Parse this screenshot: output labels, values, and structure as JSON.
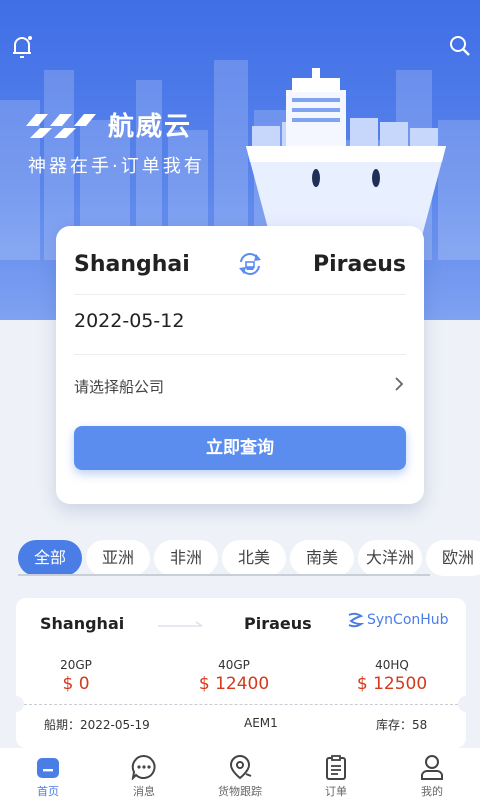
{
  "header": {
    "brand_name": "航威云",
    "slogan": "神器在手·订单我有",
    "bell_icon": "bell-icon",
    "search_icon": "search-icon"
  },
  "search_card": {
    "origin": "Shanghai",
    "destination": "Piraeus",
    "date": "2022-05-12",
    "carrier_placeholder": "请选择船公司",
    "query_button": "立即查询"
  },
  "region_tabs": {
    "items": [
      "全部",
      "亚洲",
      "非洲",
      "北美",
      "南美",
      "大洋洲",
      "欧洲"
    ],
    "active_index": 0
  },
  "result": {
    "origin": "Shanghai",
    "destination": "Piraeus",
    "carrier": "SynConHub",
    "prices": [
      {
        "type": "20GP",
        "price": "$ 0"
      },
      {
        "type": "40GP",
        "price": "$ 12400"
      },
      {
        "type": "40HQ",
        "price": "$ 12500"
      }
    ],
    "sailing_date": "船期：2022-05-19",
    "route_code": "AEM1",
    "stock": "库存：58"
  },
  "nav": {
    "items": [
      {
        "label": "首页",
        "icon": "home-icon"
      },
      {
        "label": "消息",
        "icon": "message-icon"
      },
      {
        "label": "货物跟踪",
        "icon": "location-pin-icon"
      },
      {
        "label": "订单",
        "icon": "clipboard-icon"
      },
      {
        "label": "我的",
        "icon": "person-icon"
      }
    ],
    "active_index": 0
  },
  "colors": {
    "primary": "#4a7ee6",
    "price": "#d4391c",
    "hero_top": "#3f6ee6"
  }
}
